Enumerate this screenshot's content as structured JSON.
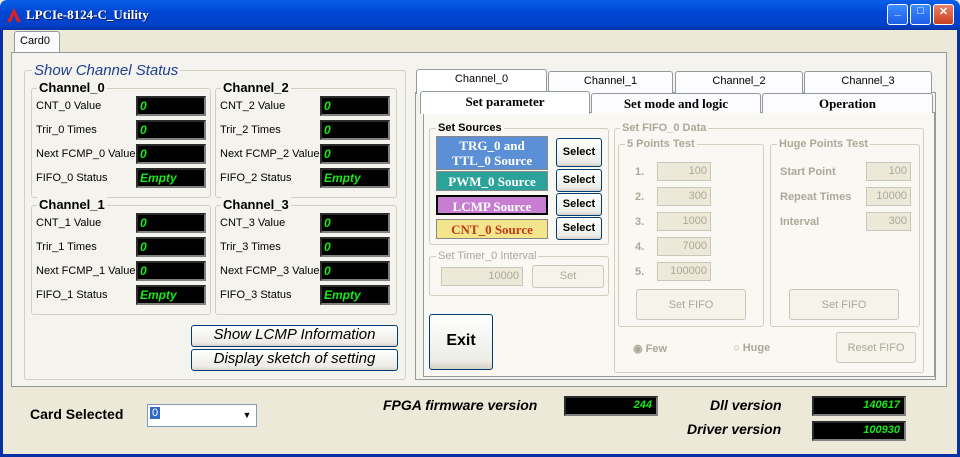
{
  "window": {
    "title": "LPCIe-8124-C_Utility",
    "min": "_",
    "max": "□",
    "close": "✕"
  },
  "card_tab": "Card0",
  "status": {
    "group": "Show Channel Status",
    "channels": [
      {
        "title": "Channel_0",
        "rows": [
          {
            "label": "CNT_0 Value",
            "value": "0"
          },
          {
            "label": "Trir_0 Times",
            "value": "0"
          },
          {
            "label": "Next FCMP_0 Value",
            "value": "0"
          },
          {
            "label": "FIFO_0 Status",
            "value": "Empty"
          }
        ]
      },
      {
        "title": "Channel_2",
        "rows": [
          {
            "label": "CNT_2 Value",
            "value": "0"
          },
          {
            "label": "Trir_2 Times",
            "value": "0"
          },
          {
            "label": "Next FCMP_2 Value",
            "value": "0"
          },
          {
            "label": "FIFO_2 Status",
            "value": "Empty"
          }
        ]
      },
      {
        "title": "Channel_1",
        "rows": [
          {
            "label": "CNT_1 Value",
            "value": "0"
          },
          {
            "label": "Trir_1 Times",
            "value": "0"
          },
          {
            "label": "Next FCMP_1 Value",
            "value": "0"
          },
          {
            "label": "FIFO_1 Status",
            "value": "Empty"
          }
        ]
      },
      {
        "title": "Channel_3",
        "rows": [
          {
            "label": "CNT_3 Value",
            "value": "0"
          },
          {
            "label": "Trir_3 Times",
            "value": "0"
          },
          {
            "label": "Next FCMP_3 Value",
            "value": "0"
          },
          {
            "label": "FIFO_3 Status",
            "value": "Empty"
          }
        ]
      }
    ],
    "show_lcmp": "Show  LCMP  Information",
    "display_sketch": "Display sketch  of  setting"
  },
  "channel_tabs": [
    "Channel_0",
    "Channel_1",
    "Channel_2",
    "Channel_3"
  ],
  "sub_tabs": [
    "Set parameter",
    "Set mode and logic",
    "Operation"
  ],
  "sources": {
    "title": "Set Sources",
    "items": [
      {
        "label": "TRG_0 and TTL_0 Source",
        "line1": "TRG_0 and",
        "line2": "TTL_0 Source",
        "bg": "#5B8FD6",
        "fg": "#FFFFFF"
      },
      {
        "label": "PWM_0 Source",
        "bg": "#2BA39A",
        "fg": "#FFFFFF"
      },
      {
        "label": "LCMP Source",
        "bg": "#C77DD0",
        "fg": "#FFFFFF"
      },
      {
        "label": "CNT_0 Source",
        "bg": "#F3E58C",
        "fg": "#C23A1A"
      }
    ],
    "select": "Select"
  },
  "timer": {
    "title": "Set Timer_0 Interval",
    "value": "10000",
    "button": "Set"
  },
  "exit": "Exit",
  "fifo": {
    "title": "Set FIFO_0 Data",
    "five": {
      "title": "5 Points Test",
      "rows": [
        {
          "n": "1.",
          "v": "100"
        },
        {
          "n": "2.",
          "v": "300"
        },
        {
          "n": "3.",
          "v": "1000"
        },
        {
          "n": "4.",
          "v": "7000"
        },
        {
          "n": "5.",
          "v": "100000"
        }
      ],
      "button": "Set FIFO"
    },
    "huge": {
      "title": "Huge Points Test",
      "rows": [
        {
          "label": "Start Point",
          "v": "100"
        },
        {
          "label": "Repeat Times",
          "v": "10000"
        },
        {
          "label": "Interval",
          "v": "300"
        }
      ],
      "button": "Set FIFO"
    },
    "few": "Few",
    "huge_radio": "Huge",
    "reset": "Reset FIFO"
  },
  "bottom": {
    "card_selected": "Card Selected",
    "card_value": "0",
    "fpga_label": "FPGA firmware version",
    "fpga_value": "244",
    "dll_label": "Dll version",
    "dll_value": "140617",
    "driver_label": "Driver version",
    "driver_value": "100930"
  }
}
